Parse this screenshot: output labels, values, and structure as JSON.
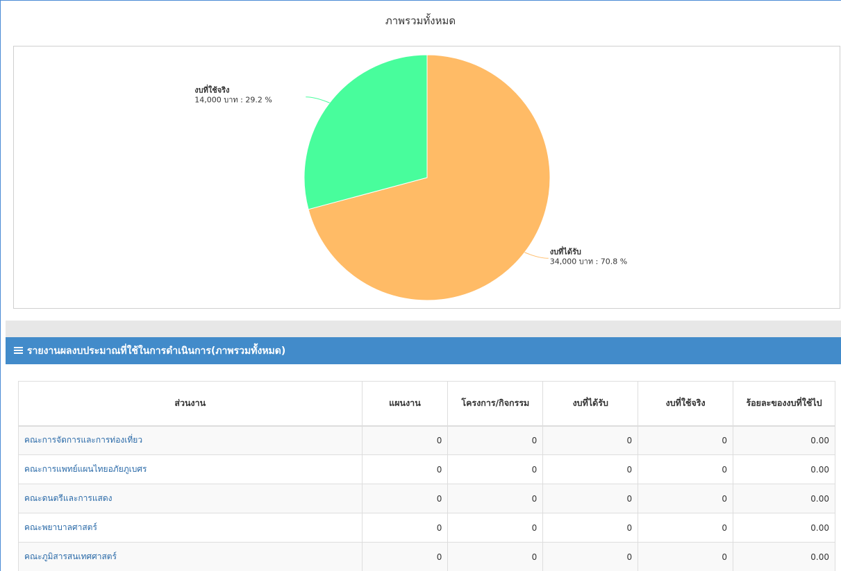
{
  "chart_data": {
    "type": "pie",
    "title": "ภาพรวมทั้งหมด",
    "slices": [
      {
        "name": "งบที่ได้รับ",
        "value": 34000,
        "percent": 70.8,
        "label": "34,000 บาท : 70.8 %",
        "color": "#ffbb66"
      },
      {
        "name": "งบที่ใช้จริง",
        "value": 14000,
        "percent": 29.2,
        "label": "14,000 บาท : 29.2 %",
        "color": "#48fd9c"
      }
    ]
  },
  "report": {
    "title": "รายงานผลงบประมาณที่ใช้ในการดำเนินการ(ภาพรวมทั้งหมด)",
    "columns": [
      "ส่วนงาน",
      "แผนงาน",
      "โครงการ/กิจกรรม",
      "งบที่ได้รับ",
      "งบที่ใช้จริง",
      "ร้อยละของงบที่ใช้ไป"
    ],
    "rows": [
      {
        "name": "คณะการจัดการและการท่องเที่ยว",
        "plan": "0",
        "project": "0",
        "received": "0",
        "used": "0",
        "percent": "0.00"
      },
      {
        "name": "คณะการแพทย์แผนไทยอภัยภูเบศร",
        "plan": "0",
        "project": "0",
        "received": "0",
        "used": "0",
        "percent": "0.00"
      },
      {
        "name": "คณะดนตรีและการแสดง",
        "plan": "0",
        "project": "0",
        "received": "0",
        "used": "0",
        "percent": "0.00"
      },
      {
        "name": "คณะพยาบาลศาสตร์",
        "plan": "0",
        "project": "0",
        "received": "0",
        "used": "0",
        "percent": "0.00"
      },
      {
        "name": "คณะภูมิสารสนเทศศาสตร์",
        "plan": "0",
        "project": "0",
        "received": "0",
        "used": "0",
        "percent": "0.00"
      }
    ]
  }
}
